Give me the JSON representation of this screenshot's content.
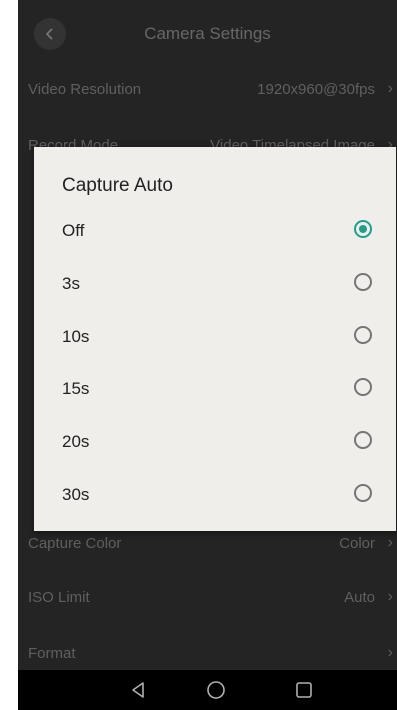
{
  "header": {
    "title": "Camera Settings"
  },
  "settings": {
    "video_resolution": {
      "label": "Video Resolution",
      "value": "1920x960@30fps"
    },
    "record_mode": {
      "label": "Record Mode",
      "value": "Video Timelapsed Image"
    },
    "capture_color": {
      "label": "Capture Color",
      "value": "Color"
    },
    "iso_limit": {
      "label": "ISO Limit",
      "value": "Auto"
    },
    "format": {
      "label": "Format",
      "value": ""
    }
  },
  "dialog": {
    "title": "Capture Auto",
    "selected": "Off",
    "options": [
      "Off",
      "3s",
      "10s",
      "15s",
      "20s",
      "30s"
    ]
  },
  "icons": {
    "back": "back-icon",
    "chevron": "chevron-right-icon",
    "nav_back": "nav-back-icon",
    "nav_home": "nav-home-icon",
    "nav_recents": "nav-recents-icon"
  },
  "colors": {
    "accent": "#229f8c",
    "background": "#2b2b2b",
    "dialog": "#f0eeeb"
  }
}
